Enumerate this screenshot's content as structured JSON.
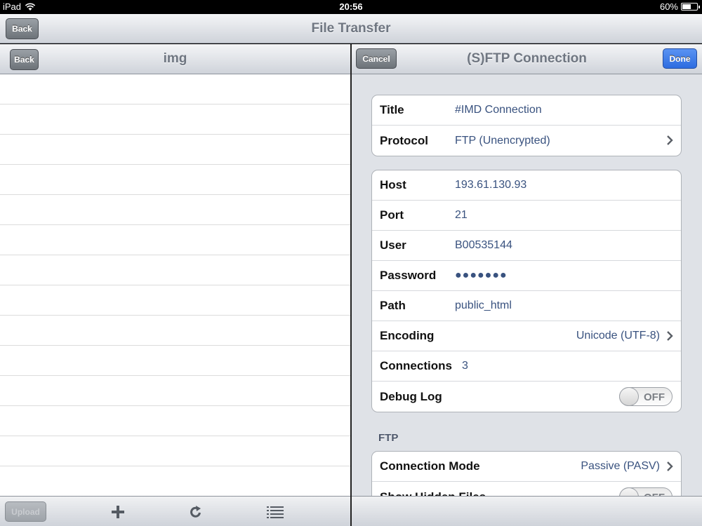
{
  "status_bar": {
    "device": "iPad",
    "time": "20:56",
    "battery": "60%",
    "battery_level": 0.6
  },
  "top_bar": {
    "back_label": "Back",
    "title": "File Transfer"
  },
  "left_panel": {
    "back_label": "Back",
    "title": "img",
    "toolbar": {
      "upload_label": "Upload"
    }
  },
  "right_panel": {
    "cancel_label": "Cancel",
    "title": "(S)FTP Connection",
    "done_label": "Done",
    "group1": [
      {
        "label": "Title",
        "value": "#IMD Connection"
      },
      {
        "label": "Protocol",
        "value": "FTP (Unencrypted)"
      }
    ],
    "group2": [
      {
        "label": "Host",
        "value": "193.61.130.93"
      },
      {
        "label": "Port",
        "value": "21"
      },
      {
        "label": "User",
        "value": "B00535144"
      },
      {
        "label": "Password",
        "value": "●●●●●●●"
      },
      {
        "label": "Path",
        "value": "public_html"
      },
      {
        "label": "Encoding",
        "value": "Unicode (UTF-8)"
      },
      {
        "label": "Connections",
        "value": "3"
      },
      {
        "label": "Debug Log",
        "toggle": "OFF"
      }
    ],
    "ftp_section": {
      "header": "FTP",
      "rows": [
        {
          "label": "Connection Mode",
          "value": "Passive (PASV)"
        },
        {
          "label": "Show Hidden Files",
          "toggle": "OFF"
        }
      ]
    }
  },
  "colors": {
    "accent_blue": "#2d6ce0",
    "value_text": "#39527f",
    "nav_title": "#6f7681"
  }
}
